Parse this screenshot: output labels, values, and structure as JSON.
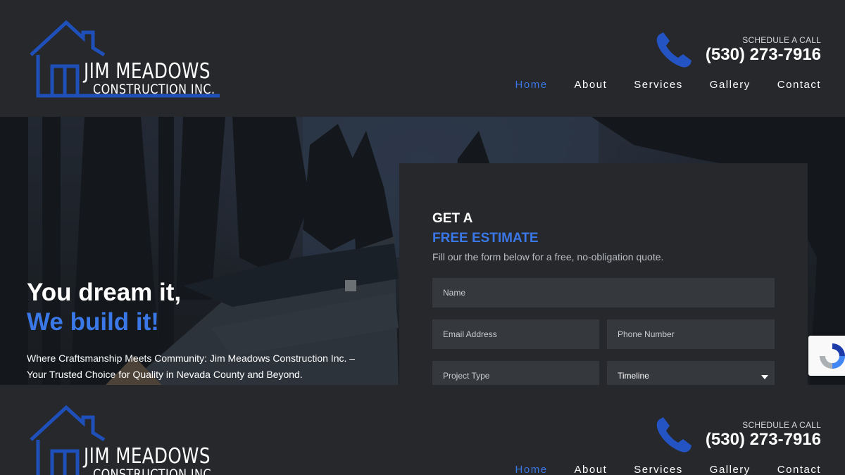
{
  "header": {
    "logo": {
      "line1": "JIM MEADOWS",
      "line2": "CONSTRUCTION INC."
    },
    "call": {
      "label": "SCHEDULE A CALL",
      "number": "(530) 273-7916",
      "icon": "phone-icon"
    },
    "nav": [
      {
        "label": "Home",
        "active": true
      },
      {
        "label": "About",
        "active": false
      },
      {
        "label": "Services",
        "active": false
      },
      {
        "label": "Gallery",
        "active": false
      },
      {
        "label": "Contact",
        "active": false
      }
    ]
  },
  "hero": {
    "headline1": "You dream it,",
    "headline2": "We build it!",
    "tagline": "Where Craftsmanship Meets Community: Jim Meadows Construction Inc. – Your Trusted Choice for Quality in Nevada County and Beyond."
  },
  "form": {
    "title1": "GET A",
    "title2": "FREE ESTIMATE",
    "subtitle": "Fill our the form below for a free, no-obligation quote.",
    "name_placeholder": "Name",
    "email_placeholder": "Email Address",
    "phone_placeholder": "Phone Number",
    "project_type_placeholder": "Project Type",
    "timeline_value": "Timeline"
  },
  "colors": {
    "accent": "#3b78e7",
    "background": "#26282b",
    "field": "#35383c",
    "logo_blue": "#1f4fb8"
  }
}
